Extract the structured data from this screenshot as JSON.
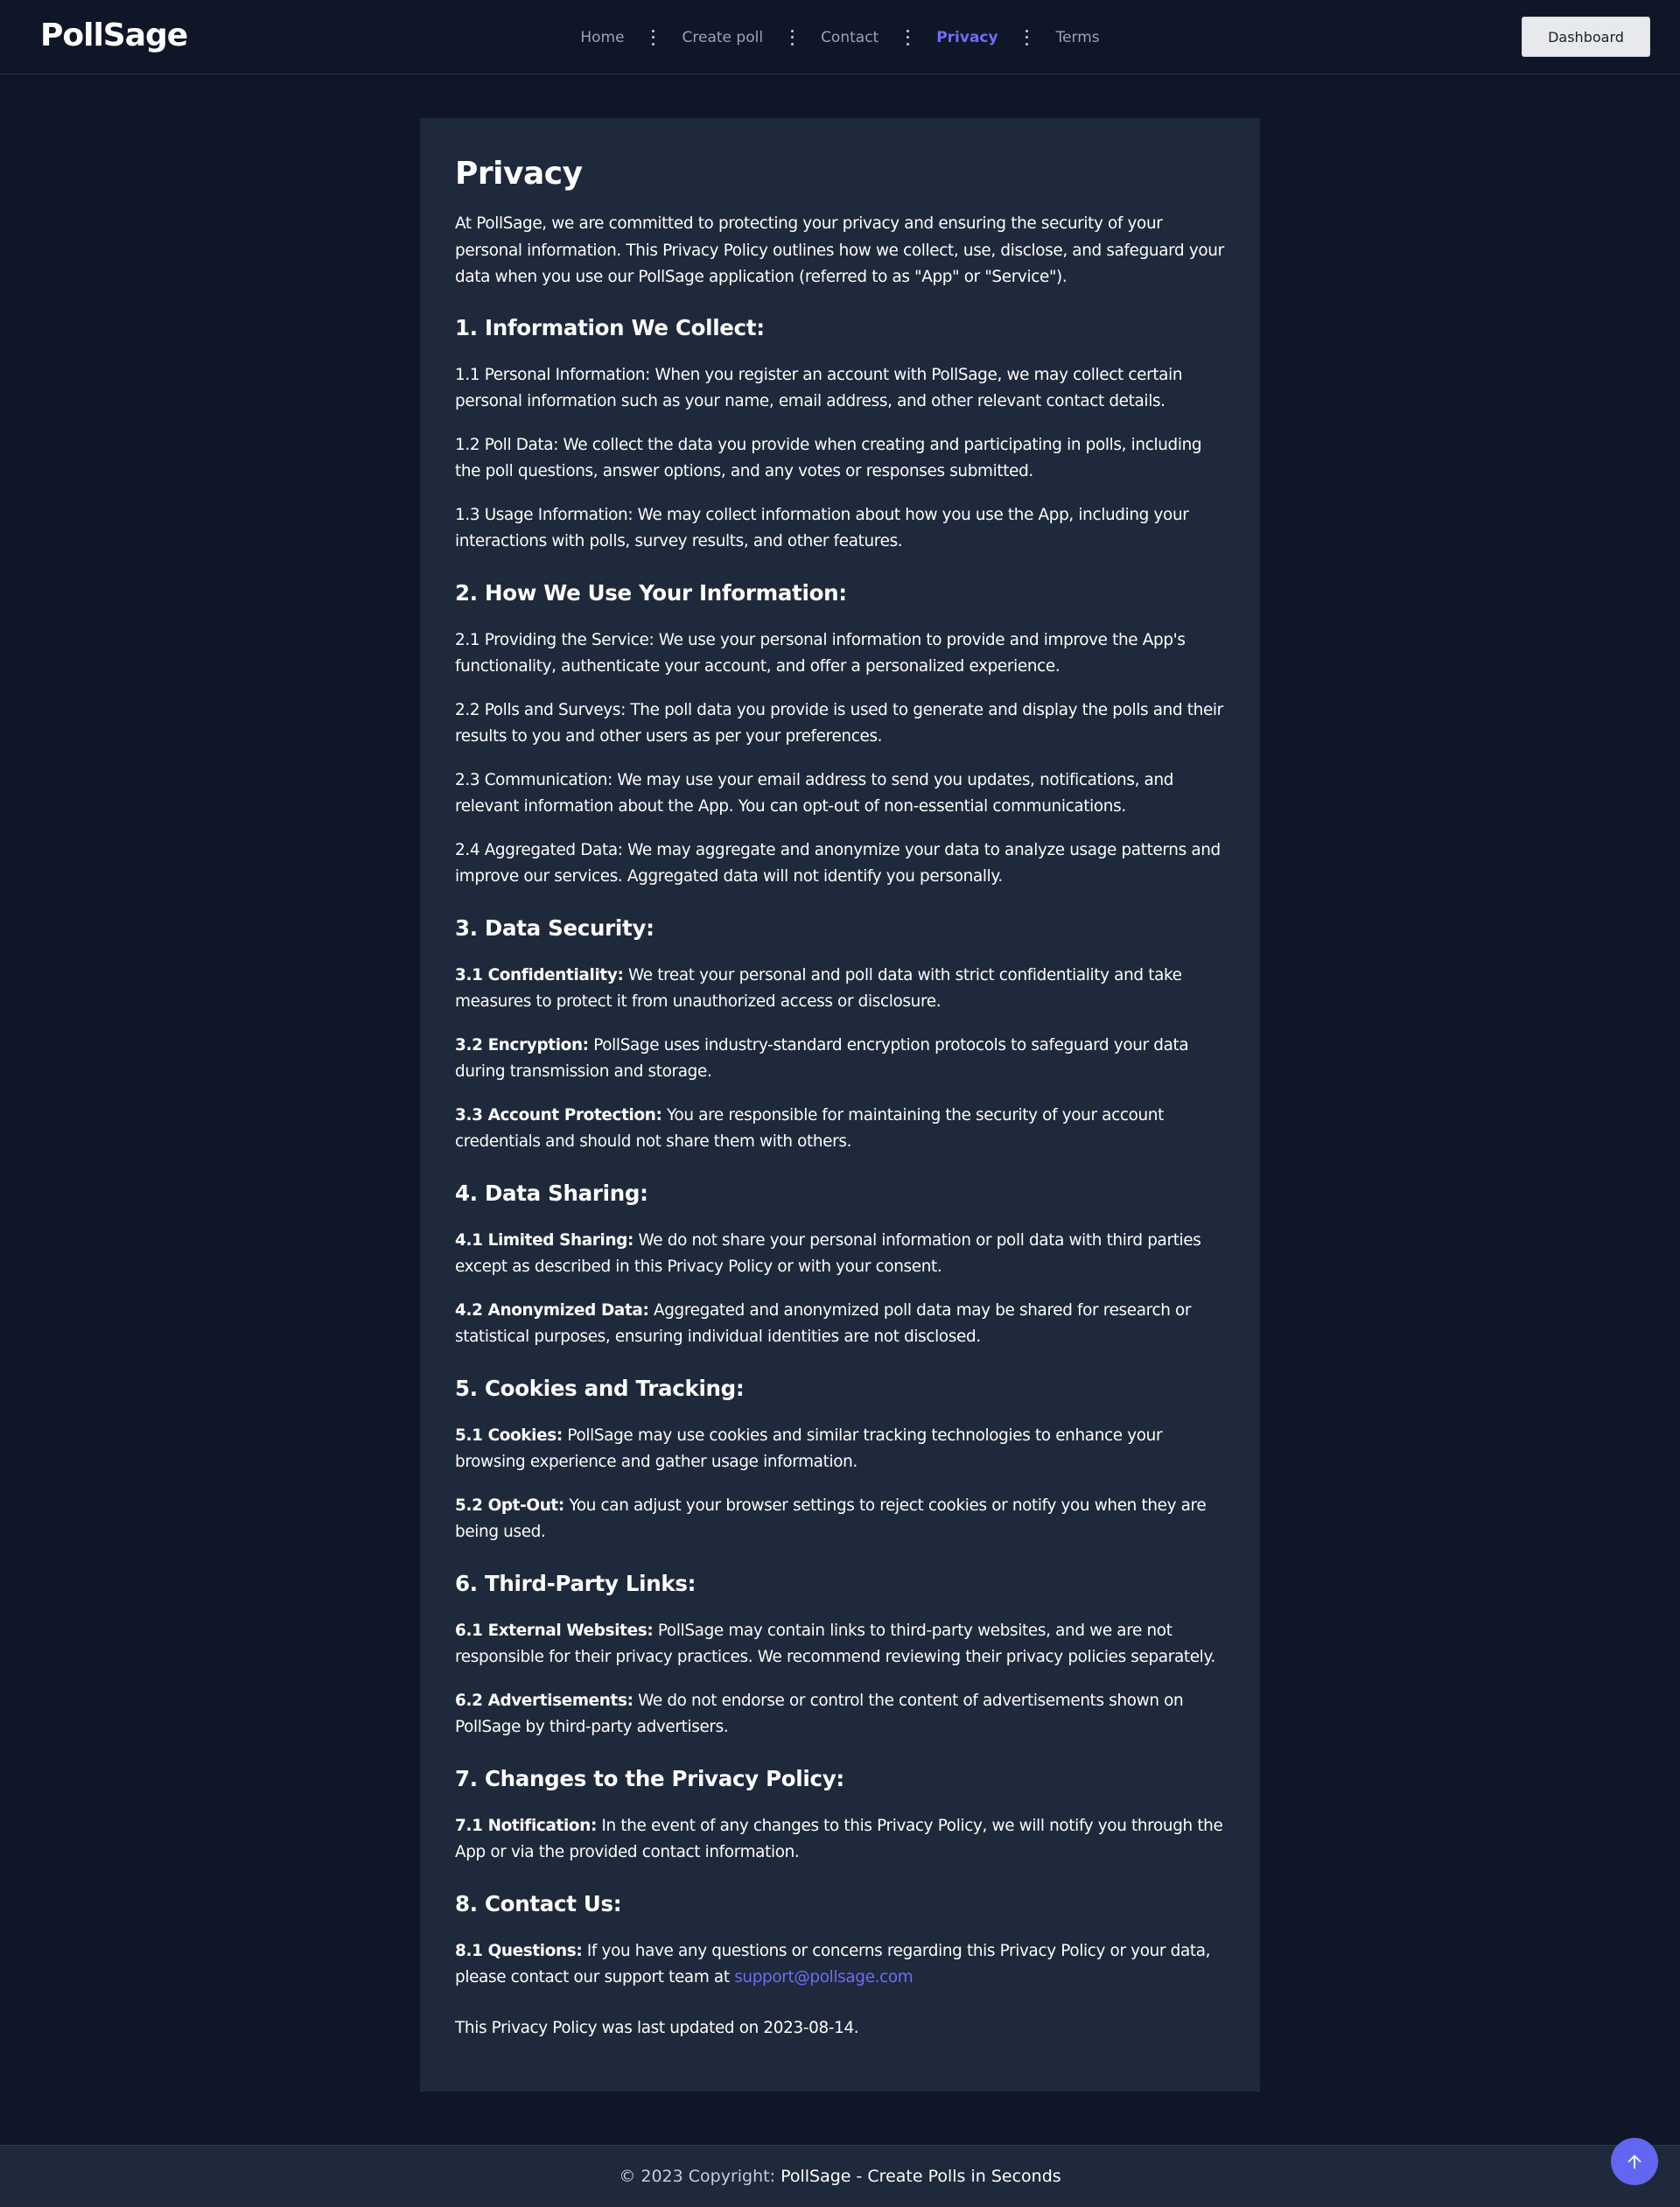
{
  "header": {
    "logo": "PollSage",
    "nav": [
      "Home",
      "Create poll",
      "Contact",
      "Privacy",
      "Terms"
    ],
    "active_nav": "Privacy",
    "dashboard_label": "Dashboard"
  },
  "content": {
    "title": "Privacy",
    "intro": "At PollSage, we are committed to protecting your privacy and ensuring the security of your personal information. This Privacy Policy outlines how we collect, use, disclose, and safeguard your data when you use our PollSage application (referred to as \"App\" or \"Service\").",
    "sections": [
      {
        "heading": "1. Information We Collect:",
        "items": [
          {
            "label": "",
            "text": "1.1 Personal Information: When you register an account with PollSage, we may collect certain personal information such as your name, email address, and other relevant contact details."
          },
          {
            "label": "",
            "text": "1.2 Poll Data: We collect the data you provide when creating and participating in polls, including the poll questions, answer options, and any votes or responses submitted."
          },
          {
            "label": "",
            "text": "1.3 Usage Information: We may collect information about how you use the App, including your interactions with polls, survey results, and other features."
          }
        ]
      },
      {
        "heading": "2. How We Use Your Information:",
        "items": [
          {
            "label": "",
            "text": "2.1 Providing the Service: We use your personal information to provide and improve the App's functionality, authenticate your account, and offer a personalized experience."
          },
          {
            "label": "",
            "text": "2.2 Polls and Surveys: The poll data you provide is used to generate and display the polls and their results to you and other users as per your preferences."
          },
          {
            "label": "",
            "text": "2.3 Communication: We may use your email address to send you updates, notifications, and relevant information about the App. You can opt-out of non-essential communications."
          },
          {
            "label": "",
            "text": "2.4 Aggregated Data: We may aggregate and anonymize your data to analyze usage patterns and improve our services. Aggregated data will not identify you personally."
          }
        ]
      },
      {
        "heading": "3. Data Security:",
        "items": [
          {
            "label": "3.1 Confidentiality:",
            "text": "We treat your personal and poll data with strict confidentiality and take measures to protect it from unauthorized access or disclosure."
          },
          {
            "label": "3.2 Encryption:",
            "text": "PollSage uses industry-standard encryption protocols to safeguard your data during transmission and storage."
          },
          {
            "label": "3.3 Account Protection:",
            "text": "You are responsible for maintaining the security of your account credentials and should not share them with others."
          }
        ]
      },
      {
        "heading": "4. Data Sharing:",
        "items": [
          {
            "label": "4.1 Limited Sharing:",
            "text": "We do not share your personal information or poll data with third parties except as described in this Privacy Policy or with your consent."
          },
          {
            "label": "4.2 Anonymized Data:",
            "text": "Aggregated and anonymized poll data may be shared for research or statistical purposes, ensuring individual identities are not disclosed."
          }
        ]
      },
      {
        "heading": "5. Cookies and Tracking:",
        "items": [
          {
            "label": "5.1 Cookies:",
            "text": "PollSage may use cookies and similar tracking technologies to enhance your browsing experience and gather usage information."
          },
          {
            "label": "5.2 Opt-Out:",
            "text": "You can adjust your browser settings to reject cookies or notify you when they are being used."
          }
        ]
      },
      {
        "heading": "6. Third-Party Links:",
        "items": [
          {
            "label": "6.1 External Websites:",
            "text": "PollSage may contain links to third-party websites, and we are not responsible for their privacy practices. We recommend reviewing their privacy policies separately."
          },
          {
            "label": "6.2 Advertisements:",
            "text": "We do not endorse or control the content of advertisements shown on PollSage by third-party advertisers."
          }
        ]
      },
      {
        "heading": "7. Changes to the Privacy Policy:",
        "items": [
          {
            "label": "7.1 Notification:",
            "text": "In the event of any changes to this Privacy Policy, we will notify you through the App or via the provided contact information."
          }
        ]
      },
      {
        "heading": "8. Contact Us:",
        "items": [
          {
            "label": "8.1 Questions:",
            "text": "If you have any questions or concerns regarding this Privacy Policy or your data, please contact our support team at",
            "link": "support@pollsage.com"
          }
        ]
      }
    ],
    "last_updated": "This Privacy Policy was last updated on 2023-08-14."
  },
  "footer": {
    "prefix": "© 2023 Copyright:",
    "brand": "PollSage - Create Polls in Seconds"
  },
  "scroll_top_icon": "arrow-up-icon",
  "colors": {
    "background": "#0f1628",
    "card": "#1e293b",
    "accent": "#6f6cf6",
    "scroll_button": "#6366f1"
  }
}
